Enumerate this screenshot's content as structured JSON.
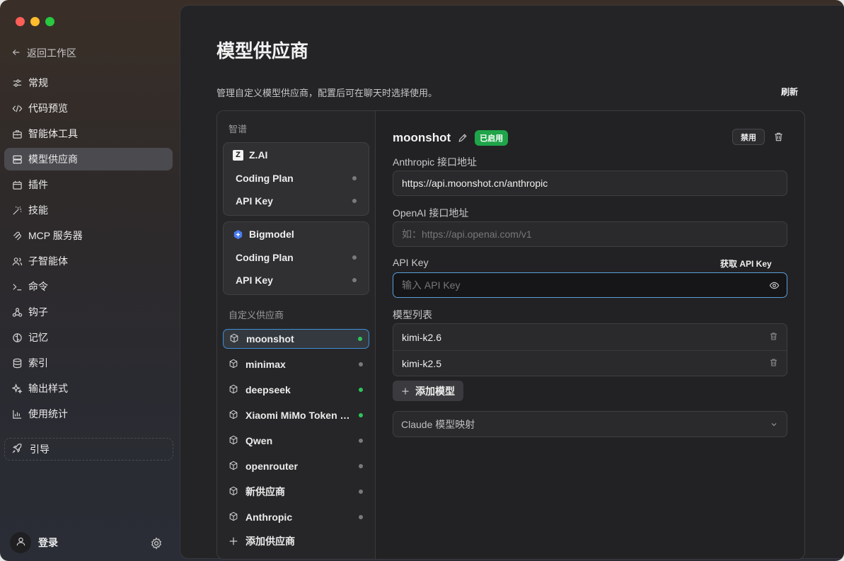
{
  "window": {
    "controls": [
      "close",
      "minimize",
      "zoom"
    ]
  },
  "sidebar": {
    "back_label": "返回工作区",
    "items": [
      {
        "label": "常规",
        "icon": "sliders-icon"
      },
      {
        "label": "代码预览",
        "icon": "code-icon"
      },
      {
        "label": "智能体工具",
        "icon": "toolbox-icon"
      },
      {
        "label": "模型供应商",
        "icon": "server-icon",
        "active": true
      },
      {
        "label": "插件",
        "icon": "plugin-icon"
      },
      {
        "label": "技能",
        "icon": "wand-icon"
      },
      {
        "label": "MCP 服务器",
        "icon": "mcp-icon"
      },
      {
        "label": "子智能体",
        "icon": "users-icon"
      },
      {
        "label": "命令",
        "icon": "terminal-icon"
      },
      {
        "label": "钩子",
        "icon": "webhook-icon"
      },
      {
        "label": "记忆",
        "icon": "brain-icon"
      },
      {
        "label": "索引",
        "icon": "database-icon"
      },
      {
        "label": "输出样式",
        "icon": "sparkles-icon"
      },
      {
        "label": "使用统计",
        "icon": "bar-chart-icon"
      }
    ],
    "guide_label": "引导",
    "login_label": "登录"
  },
  "main": {
    "title": "模型供应商",
    "description": "管理自定义模型供应商，配置后可在聊天时选择使用。",
    "refresh_label": "刷新"
  },
  "providers": {
    "zhipu_label": "智谱",
    "zai": {
      "name": "Z.AI",
      "rows": [
        "Coding Plan",
        "API Key"
      ]
    },
    "bigmodel": {
      "name": "Bigmodel",
      "rows": [
        "Coding Plan",
        "API Key"
      ]
    },
    "custom_label": "自定义供应商",
    "custom": [
      {
        "name": "moonshot",
        "status": "enabled",
        "active": true
      },
      {
        "name": "minimax",
        "status": "disabled"
      },
      {
        "name": "deepseek",
        "status": "enabled"
      },
      {
        "name": "Xiaomi MiMo Token Plan",
        "status": "enabled"
      },
      {
        "name": "Qwen",
        "status": "disabled"
      },
      {
        "name": "openrouter",
        "status": "disabled"
      },
      {
        "name": "新供应商",
        "status": "disabled"
      },
      {
        "name": "Anthropic",
        "status": "disabled"
      }
    ],
    "add_label": "添加供应商"
  },
  "detail": {
    "name": "moonshot",
    "badge": "已启用",
    "disable_label": "禁用",
    "anthropic_label": "Anthropic 接口地址",
    "anthropic_value": "https://api.moonshot.cn/anthropic",
    "openai_label": "OpenAI 接口地址",
    "openai_placeholder": "如：https://api.openai.com/v1",
    "apikey_label": "API Key",
    "get_key_label": "获取 API Key",
    "apikey_placeholder": "输入 API Key",
    "models_label": "模型列表",
    "models": [
      "kimi-k2.6",
      "kimi-k2.5"
    ],
    "add_model_label": "添加模型",
    "mapping_label": "Claude 模型映射"
  },
  "colors": {
    "accent_blue": "#5a9ed9",
    "enabled_green": "#1fa44a",
    "status_green": "#2fc35b"
  }
}
